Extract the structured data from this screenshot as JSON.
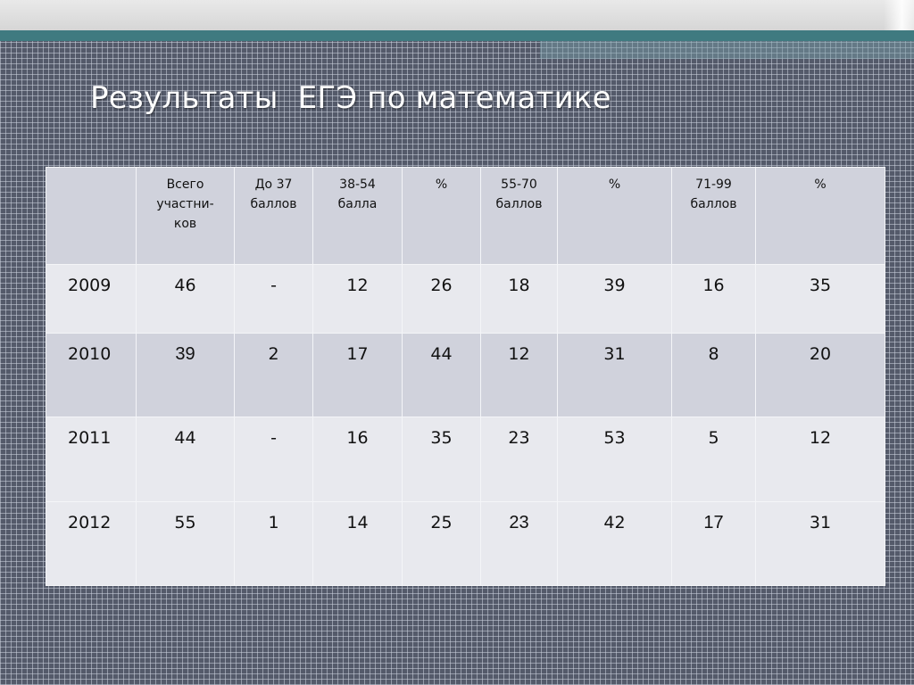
{
  "slide": {
    "title": "Результаты  ЕГЭ по математике"
  },
  "colors": {
    "accent_teal": "#3f7a80",
    "header_row": "#d0d2dc",
    "light_row": "#e8e9ee",
    "background": "#545a6a"
  },
  "table": {
    "headers": [
      "",
      "Всего участни-ков",
      "До 37 баллов",
      "38-54 балла",
      "%",
      "55-70 баллов",
      "%",
      "71-99 баллов",
      "%"
    ],
    "rows": [
      [
        "2009",
        "46",
        "-",
        "12",
        "26",
        "18",
        "39",
        "16",
        "35"
      ],
      [
        "2010",
        "39",
        "2",
        "17",
        "44",
        "12",
        "31",
        "8",
        "20"
      ],
      [
        "2011",
        "44",
        "-",
        "16",
        "35",
        "23",
        "53",
        "5",
        "12"
      ],
      [
        "2012",
        "55",
        "1",
        "14",
        "25",
        "23",
        "42",
        "17",
        "31"
      ]
    ]
  }
}
